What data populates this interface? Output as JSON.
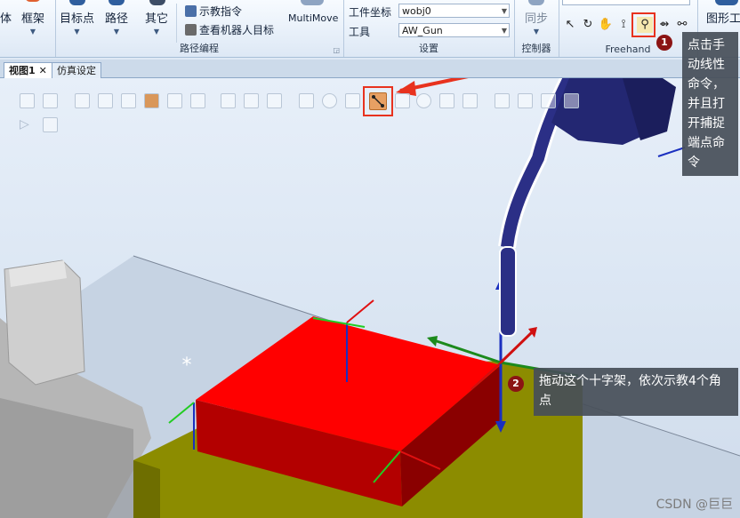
{
  "ribbon": {
    "partial_left": "体",
    "frame": "框架",
    "target_point": "目标点",
    "path": "路径",
    "other": "其它",
    "teach_instruction": "示教指令",
    "view_robot_target": "查看机器人目标",
    "multimove": "MultiMove",
    "group_path_programming": "路径编程",
    "workobject_label": "工件坐标",
    "workobject_value": "wobj0",
    "tool_label": "工具",
    "tool_value": "AW_Gun",
    "group_settings": "设置",
    "sync": "同步",
    "group_controller": "控制器",
    "group_freehand": "Freehand",
    "graphics_partial": "图形工"
  },
  "tabs": [
    {
      "label": "视图1",
      "active": true
    },
    {
      "label": "仿真设定",
      "active": false
    }
  ],
  "callouts": {
    "step1_number": "1",
    "step1_text": "点击手动线性命令，并且打开捕捉端点命令",
    "step2_number": "2",
    "step2_text": "拖动这个十字架，依次示教4个角点"
  },
  "watermark": "CSDN @巨巨",
  "colors": {
    "highlight": "#e8321e",
    "red_box": "#ff0000",
    "table_top": "#8c8c00",
    "robot_arm": "#2b2f86"
  }
}
